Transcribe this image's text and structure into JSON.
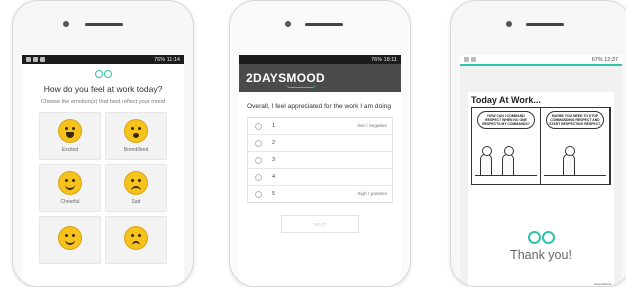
{
  "phone1": {
    "status": {
      "time": "11:14",
      "battery": "76%"
    },
    "title": "How do you feel at work today?",
    "subtitle": "Choose the emotion(s) that best reflect your mood",
    "emotions": [
      {
        "label": "Excited",
        "icon": "grin-icon"
      },
      {
        "label": "Bored/tired",
        "icon": "yawn-icon"
      },
      {
        "label": "Cheerful",
        "icon": "wink-tongue-icon"
      },
      {
        "label": "Sad",
        "icon": "sad-icon"
      },
      {
        "label": "",
        "icon": "smile-icon"
      },
      {
        "label": "",
        "icon": "worried-icon"
      }
    ]
  },
  "phone2": {
    "status": {
      "time": "18:11",
      "battery": "76%"
    },
    "brand": "2DAYSMOOD",
    "question": "Overall, I feel appreciated for the work I am doing",
    "options": [
      {
        "num": "1",
        "label": "low / negative"
      },
      {
        "num": "2",
        "label": ""
      },
      {
        "num": "3",
        "label": ""
      },
      {
        "num": "4",
        "label": ""
      },
      {
        "num": "5",
        "label": "high / positive"
      }
    ],
    "next_label": "NEXT"
  },
  "phone3": {
    "status": {
      "time": "12:37",
      "battery": "67%"
    },
    "comic_title": "Today At Work...",
    "bubble_left": "HOW CAN I COMMAND RESPECT WHEN NO ONE RESPECTS MY COMMANDS?",
    "bubble_right": "MAYBE YOU NEED TO STOP COMMANDING RESPECT AND START RESPECTING RESPECT.",
    "comic_credit": "Scott Adams",
    "thanks": "Thank you!"
  },
  "colors": {
    "accent": "#2ec4a8",
    "brand_bar": "#4b4b4b"
  }
}
